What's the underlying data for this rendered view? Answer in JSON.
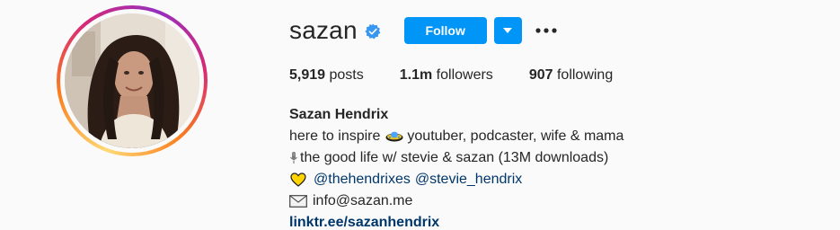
{
  "profile": {
    "username": "sazan",
    "verified_icon": "verified-badge-icon",
    "follow_label": "Follow",
    "dropdown_icon": "caret-down-icon",
    "more_icon": "more-options-icon"
  },
  "stats": {
    "posts_count": "5,919",
    "posts_label": "posts",
    "followers_count": "1.1m",
    "followers_label": "followers",
    "following_count": "907",
    "following_label": "following"
  },
  "bio": {
    "full_name": "Sazan Hendrix",
    "line1_prefix": "here to inspire",
    "line1_suffix": "youtuber, podcaster, wife & mama",
    "line2": "the good life w/ stevie & sazan (13M downloads)",
    "mention1": "@thehendrixes",
    "mention2": "@stevie_hendrix",
    "email": "info@sazan.me",
    "link": "linktr.ee/sazanhendrix"
  },
  "colors": {
    "accent": "#0095f6",
    "link": "#00376b",
    "text": "#262626",
    "background": "#fafafa"
  }
}
